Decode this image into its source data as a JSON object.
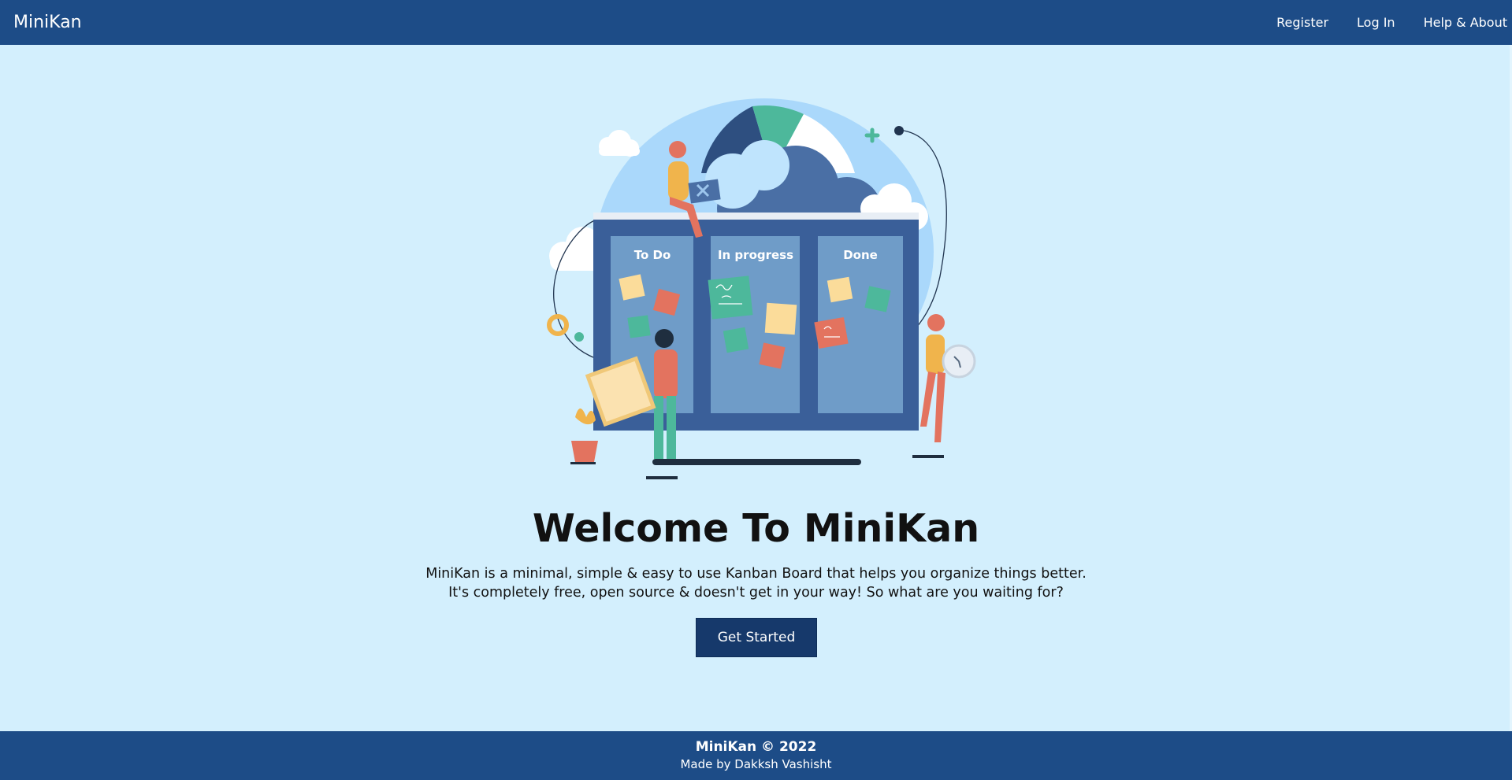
{
  "navbar": {
    "brand": "MiniKan",
    "links": [
      {
        "label": "Register"
      },
      {
        "label": "Log In"
      },
      {
        "label": "Help & About"
      }
    ]
  },
  "hero": {
    "columns": [
      {
        "label": "To Do"
      },
      {
        "label": "In progress"
      },
      {
        "label": "Done"
      }
    ]
  },
  "main": {
    "title": "Welcome To MiniKan",
    "description_line1": "MiniKan is a minimal, simple & easy to use Kanban Board that helps you organize things better.",
    "description_line2": "It's completely free, open source & doesn't get in your way! So what are you waiting for?",
    "cta_label": "Get Started"
  },
  "footer": {
    "title": "MiniKan © 2022",
    "credit": "Made by Dakksh Vashisht"
  },
  "colors": {
    "navbar": "#1d4c87",
    "background": "#d3effd",
    "button": "#16396b",
    "board": "#3a5f99",
    "column": "#6f9cc8"
  }
}
